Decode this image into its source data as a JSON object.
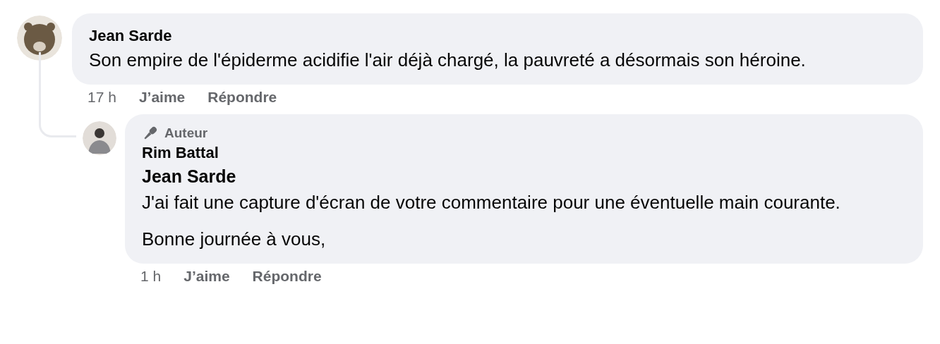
{
  "comments": [
    {
      "author": "Jean Sarde",
      "paragraphs": [
        "Son empire de l'épiderme acidifie l'air déjà chargé, la pauvreté a désormais son héroine."
      ],
      "time": "17 h",
      "like": "J’aime",
      "reply": "Répondre",
      "replies": [
        {
          "author": "Rim Battal",
          "badge": "Auteur",
          "mention": "Jean Sarde",
          "paragraphs": [
            "J'ai fait une capture d'écran de votre commentaire pour une éventuelle main courante.",
            "Bonne journée à vous,"
          ],
          "time": "1 h",
          "like": "J’aime",
          "reply": "Répondre"
        }
      ]
    }
  ]
}
